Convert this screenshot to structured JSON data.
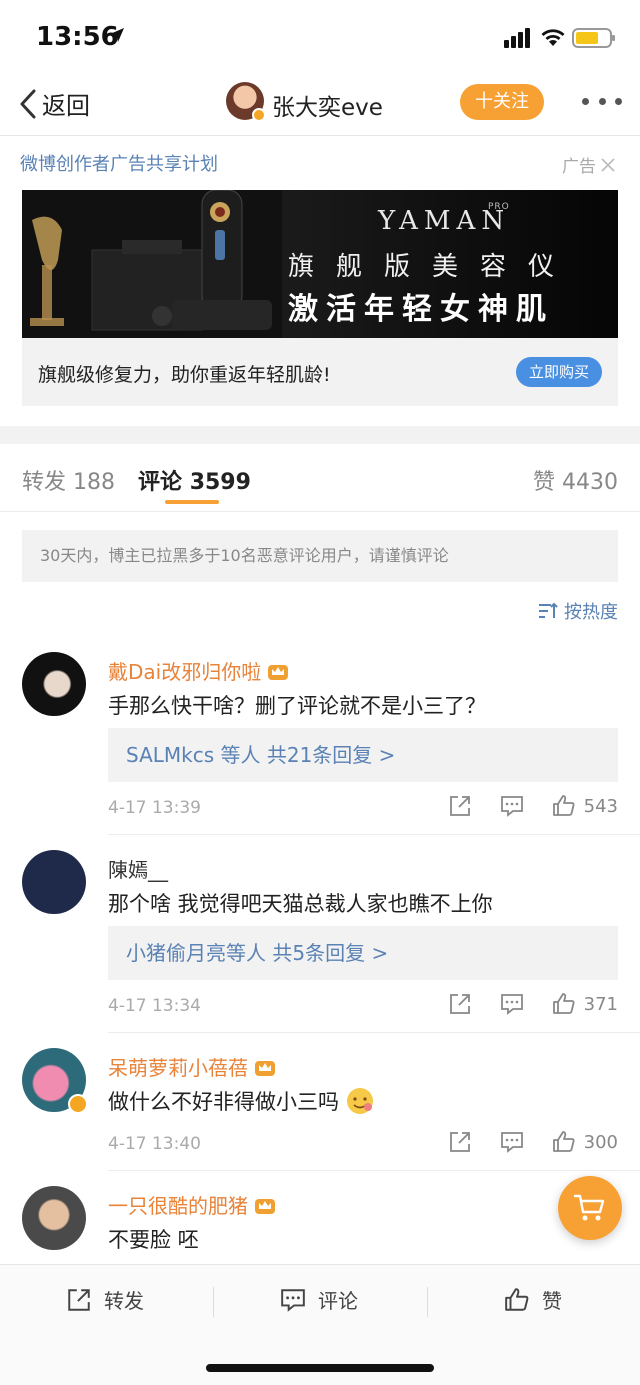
{
  "status_bar": {
    "time": "13:56"
  },
  "nav": {
    "back_label": "返回",
    "username": "张大奕eve",
    "follow_label": "十关注"
  },
  "ad": {
    "title": "微博创作者广告共享计划",
    "tag": "广告",
    "brand": "YAMAN",
    "brand_sub": "PRO",
    "line1": "旗舰版美容仪",
    "line2": "激活年轻女神肌",
    "description": "旗舰级修复力，助你重返年轻肌龄!",
    "buy_label": "立即购买"
  },
  "tabs": {
    "repost": {
      "label": "转发",
      "count": "188"
    },
    "comment": {
      "label": "评论",
      "count": "3599"
    },
    "like": {
      "label": "赞",
      "count": "4430"
    }
  },
  "notice": "30天内，博主已拉黑多于10名恶意评论用户，请谨慎评论",
  "sort_label": "按热度",
  "comments": [
    {
      "name": "戴Dai改邪归你啦",
      "text": "手那么快干啥？删了评论就不是小三了？",
      "replies": "SALMkcs 等人  共21条回复 >",
      "time": "4-17 13:39",
      "likes": "543"
    },
    {
      "name": "陳嫣__",
      "text": "那个啥 我觉得吧天猫总裁人家也瞧不上你",
      "replies": "小猪偷月亮等人  共5条回复 >",
      "time": "4-17 13:34",
      "likes": "371"
    },
    {
      "name": "呆萌萝莉小蓓蓓",
      "text": "做什么不好非得做小三吗",
      "time": "4-17 13:40",
      "likes": "300"
    },
    {
      "name": "一只很酷的肥猪",
      "text": "不要脸 呸"
    }
  ],
  "bottom_bar": {
    "repost_label": "转发",
    "comment_label": "评论",
    "like_label": "赞"
  },
  "colors": {
    "accent_orange": "#f7a134",
    "link_blue": "#5a82b4",
    "username_orange": "#e8833a",
    "buy_blue": "#4a90e2"
  },
  "icons": [
    "location-arrow-icon",
    "signal-icon",
    "wifi-icon",
    "battery-icon",
    "back-chevron-icon",
    "more-dots-icon",
    "close-icon",
    "sort-icon",
    "crown-icon",
    "share-icon",
    "comment-icon",
    "like-icon",
    "cart-icon",
    "emoji-icon"
  ]
}
